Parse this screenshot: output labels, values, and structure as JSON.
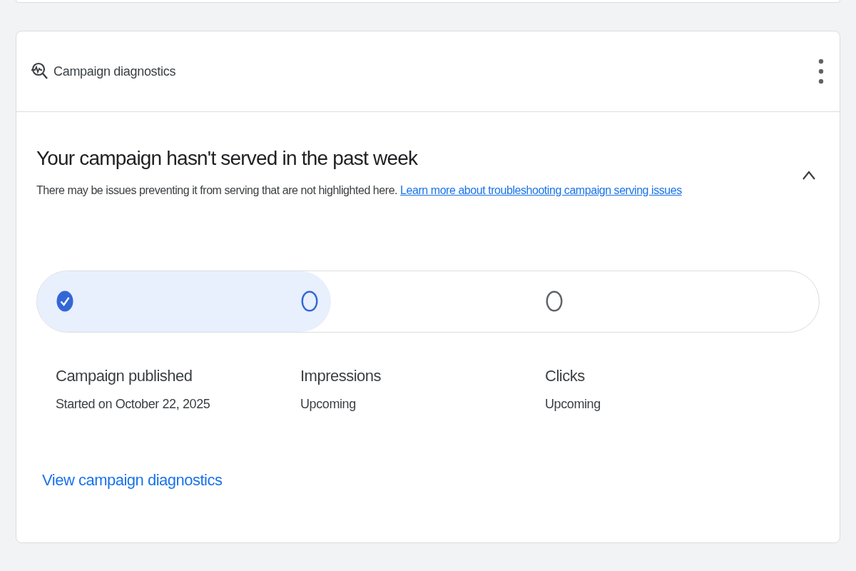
{
  "card": {
    "title": "Campaign diagnostics"
  },
  "alert": {
    "title": "Your campaign hasn't served in the past week",
    "expanded": true,
    "description": "There may be issues preventing it from serving that are not highlighted here.",
    "link": "Learn more about troubleshooting campaign serving issues"
  },
  "progress": {
    "level": 0.376
  },
  "steps": [
    {
      "label": "Campaign published",
      "detail": "Started on October 22, 2025",
      "kind": "complete"
    },
    {
      "label": "Impressions",
      "detail": "Upcoming",
      "kind": "current"
    },
    {
      "label": "Clicks",
      "detail": "Upcoming",
      "kind": "upcoming"
    }
  ],
  "footer_link": "View campaign diagnostics"
}
